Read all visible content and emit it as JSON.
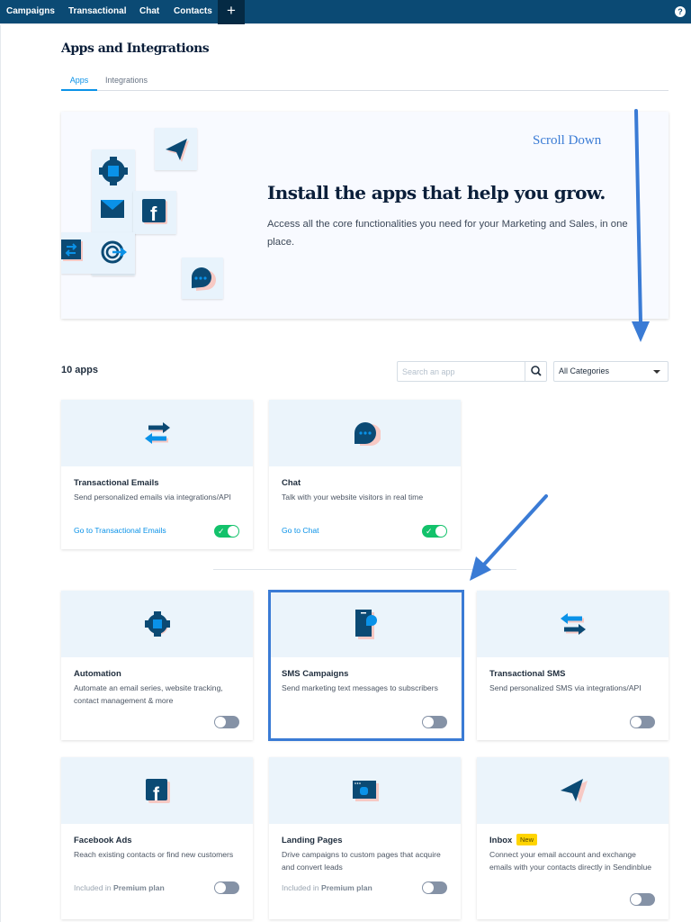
{
  "topnav": {
    "items": [
      {
        "label": "Campaigns"
      },
      {
        "label": "Transactional"
      },
      {
        "label": "Chat"
      },
      {
        "label": "Contacts"
      }
    ],
    "add_label": "+",
    "help_label": "?"
  },
  "page": {
    "title": "Apps and Integrations",
    "tabs": [
      {
        "label": "Apps",
        "active": true
      },
      {
        "label": "Integrations",
        "active": false
      }
    ]
  },
  "banner": {
    "title": "Install the apps that help you grow.",
    "text": "Access all the core functionalities you need for your Marketing and Sales, in one place.",
    "annotation": "Scroll Down",
    "icons": [
      "paper-plane-icon",
      "gear-icon",
      "envelope-icon",
      "facebook-icon",
      "transfer-icon",
      "target-icon",
      "chat-bubble-icon"
    ]
  },
  "toolbar": {
    "count_label": "10 apps",
    "search_placeholder": "Search an app",
    "search_value": "",
    "category_selected": "All Categories"
  },
  "installed_apps": [
    {
      "name": "Transactional Emails",
      "description": "Send personalized emails via integrations/API",
      "link": "Go to Transactional Emails",
      "enabled": true,
      "icon": "transfer-icon"
    },
    {
      "name": "Chat",
      "description": "Talk with your website visitors in real time",
      "link": "Go to Chat",
      "enabled": true,
      "icon": "chat-bubble-icon"
    }
  ],
  "available_apps": [
    {
      "name": "Automation",
      "description": "Automate an email series, website tracking, contact management & more",
      "enabled": false,
      "icon": "gear-icon"
    },
    {
      "name": "SMS Campaigns",
      "description": "Send marketing text messages to subscribers",
      "enabled": false,
      "icon": "phone-message-icon",
      "highlighted": true
    },
    {
      "name": "Transactional SMS",
      "description": "Send personalized SMS via integrations/API",
      "enabled": false,
      "icon": "transfer-icon"
    },
    {
      "name": "Facebook Ads",
      "description": "Reach existing contacts or find new customers",
      "plan_prefix": "Included in",
      "plan_name": "Premium plan",
      "enabled": false,
      "icon": "facebook-icon"
    },
    {
      "name": "Landing Pages",
      "description": "Drive campaigns to custom pages that acquire and convert leads",
      "plan_prefix": "Included in",
      "plan_name": "Premium plan",
      "enabled": false,
      "icon": "browser-window-icon"
    },
    {
      "name": "Inbox",
      "badge": "New",
      "description": "Connect your email account and exchange emails with your contacts directly in Sendinblue",
      "enabled": false,
      "icon": "paper-plane-icon"
    }
  ],
  "colors": {
    "nav_bg": "#0b4a74",
    "accent": "#0a92e8",
    "toggle_on": "#13c26b",
    "toggle_off": "#8592a6",
    "annotation": "#3a7bd5",
    "badge": "#ffd400"
  }
}
